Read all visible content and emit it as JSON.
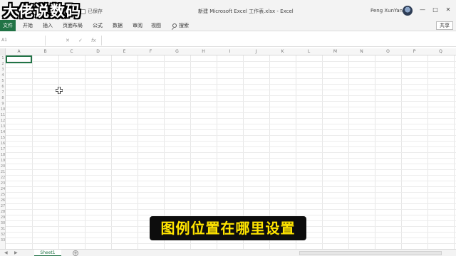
{
  "watermark": "大佬说数码",
  "window": {
    "qat_label": "已保存",
    "doc_title": "新建 Microsoft Excel 工作表.xlsx  -  Excel",
    "user_name": "Peng XunYan",
    "minimize": "—",
    "maximize": "□",
    "close": "✕"
  },
  "ribbon": {
    "file_tab": "文件",
    "tabs": [
      "开始",
      "插入",
      "页面布局",
      "公式",
      "数据",
      "审阅",
      "视图"
    ],
    "search_label": "搜索",
    "share_label": "共享"
  },
  "formula_bar": {
    "name_box": "A1",
    "cancel": "✕",
    "enter": "✓",
    "fx": "fx",
    "formula": ""
  },
  "grid": {
    "columns": [
      "A",
      "B",
      "C",
      "D",
      "E",
      "F",
      "G",
      "H",
      "I",
      "J",
      "K",
      "L",
      "M",
      "N",
      "O",
      "P",
      "Q"
    ],
    "rows": [
      "1",
      "2",
      "3",
      "4",
      "5",
      "6",
      "7",
      "8",
      "9",
      "10",
      "11",
      "12",
      "13",
      "14",
      "15",
      "16",
      "17",
      "18",
      "19",
      "20",
      "21",
      "22",
      "23",
      "24",
      "25",
      "26",
      "27",
      "28",
      "29",
      "30",
      "31",
      "32",
      "33"
    ]
  },
  "sheets": {
    "active": "Sheet1",
    "add": "+",
    "prev": "◀",
    "next": "▶"
  },
  "subtitle": "图例位置在哪里设置",
  "colors": {
    "excel_green": "#217346",
    "subtitle_yellow": "#ffe400",
    "subtitle_bg": "#0d0d0d"
  }
}
